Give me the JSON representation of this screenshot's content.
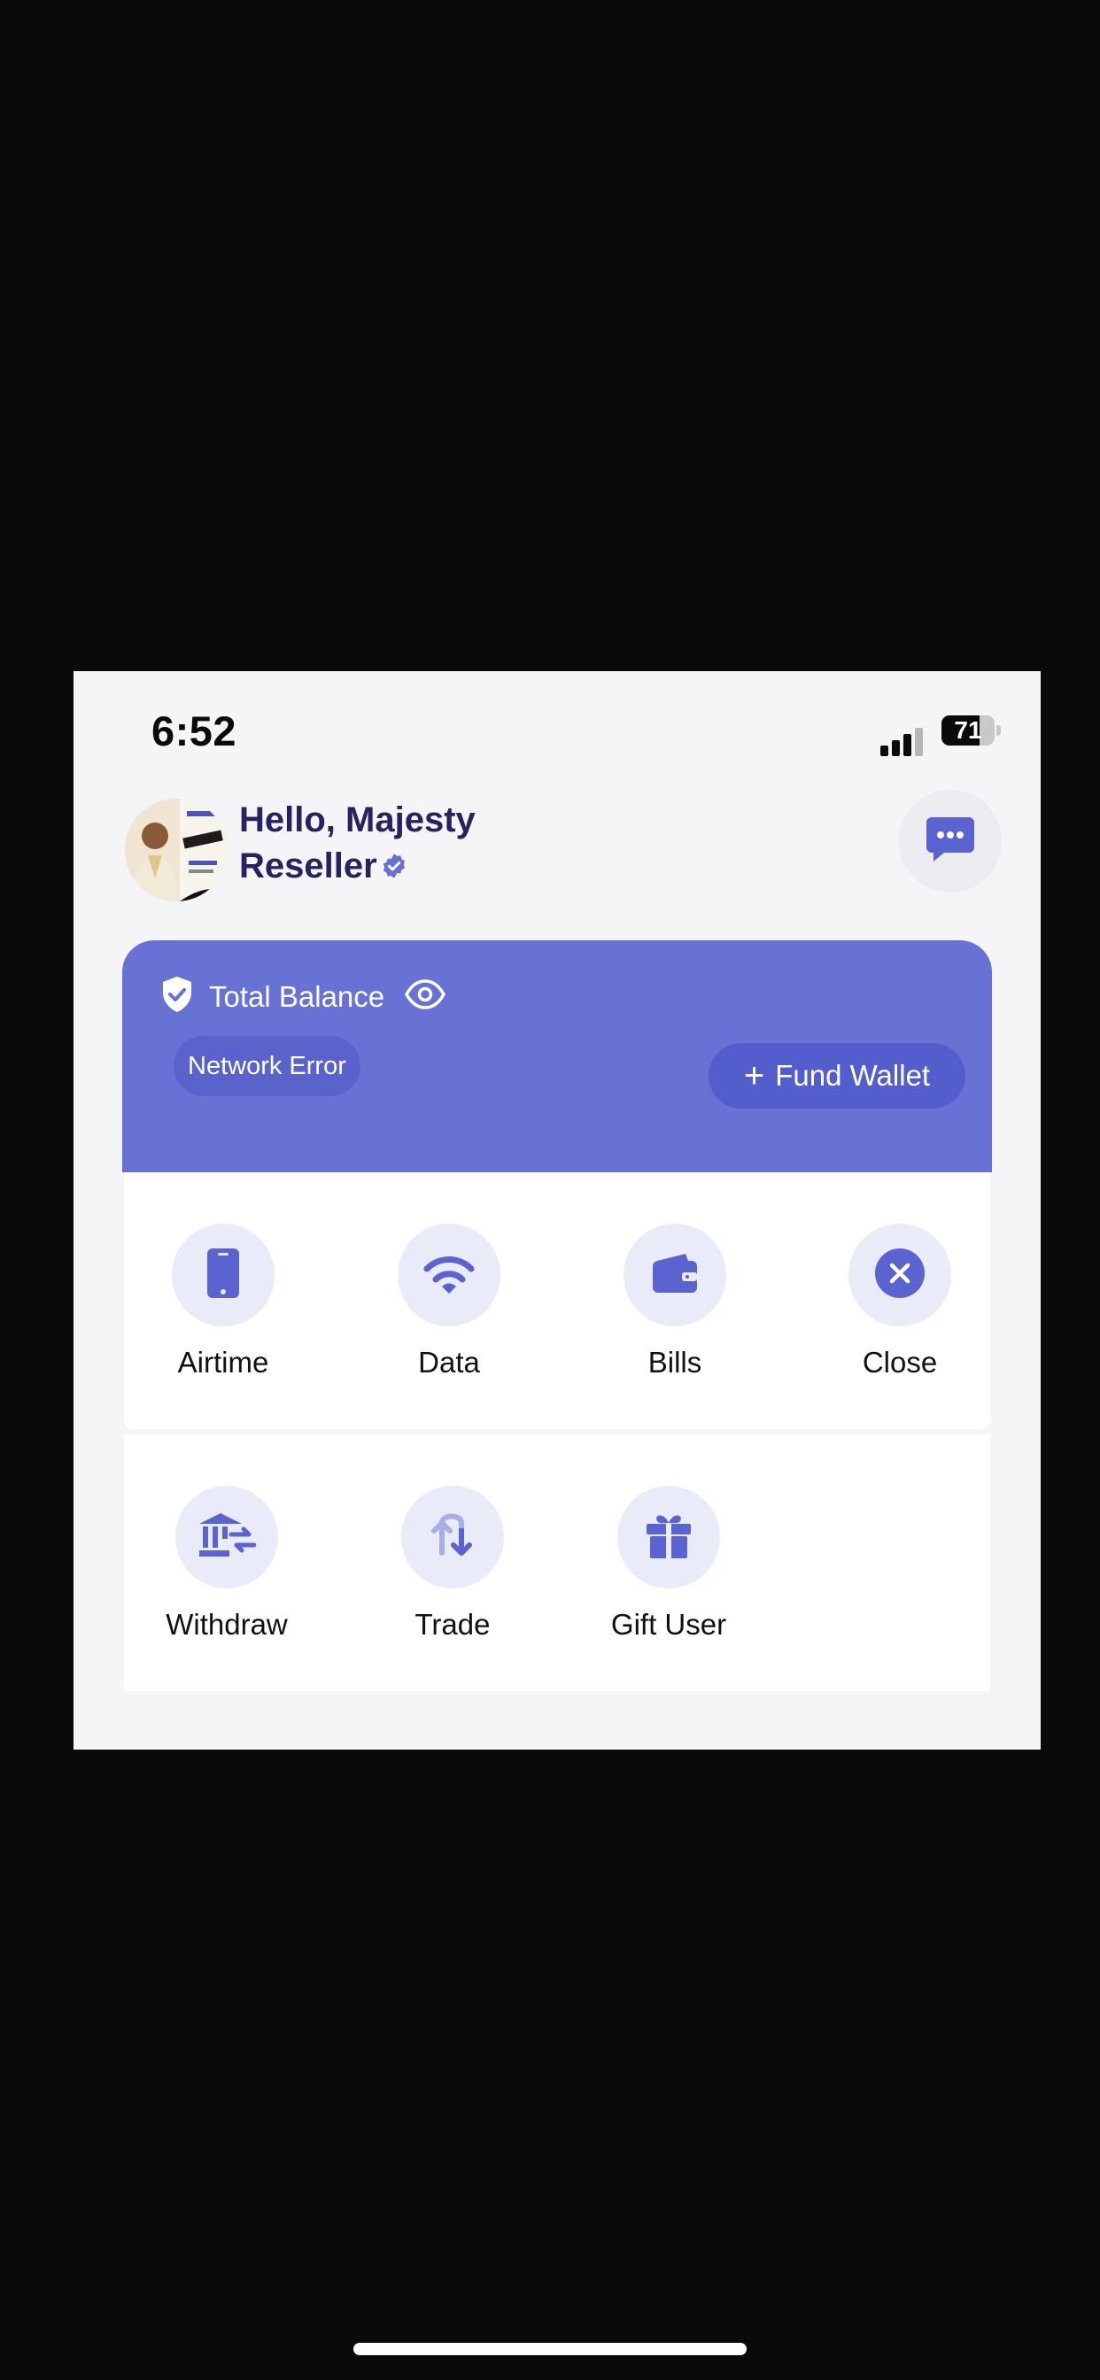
{
  "status_bar": {
    "time": "6:52",
    "battery": "71",
    "battery_level": 0.71
  },
  "header": {
    "greeting_line1": "Hello, Majesty",
    "greeting_line2": "Reseller",
    "chat_icon": "chat-bubble-icon",
    "verified_icon": "verified-badge-icon"
  },
  "balance": {
    "label": "Total Balance",
    "status": "Network Error",
    "fund_button": "Fund Wallet",
    "shield_icon": "shield-check-icon",
    "eye_icon": "eye-icon"
  },
  "actions_row1": [
    {
      "label": "Airtime",
      "icon": "phone-icon"
    },
    {
      "label": "Data",
      "icon": "wifi-icon"
    },
    {
      "label": "Bills",
      "icon": "wallet-icon"
    },
    {
      "label": "Close",
      "icon": "close-circle-icon"
    }
  ],
  "actions_row2": [
    {
      "label": "Withdraw",
      "icon": "bank-transfer-icon"
    },
    {
      "label": "Trade",
      "icon": "swap-icon"
    },
    {
      "label": "Gift User",
      "icon": "gift-icon"
    }
  ],
  "colors": {
    "accent": "#6872d4",
    "accent_dark": "#545dcc",
    "icon_bg": "#e9ecf8",
    "title_text": "#27235e"
  }
}
